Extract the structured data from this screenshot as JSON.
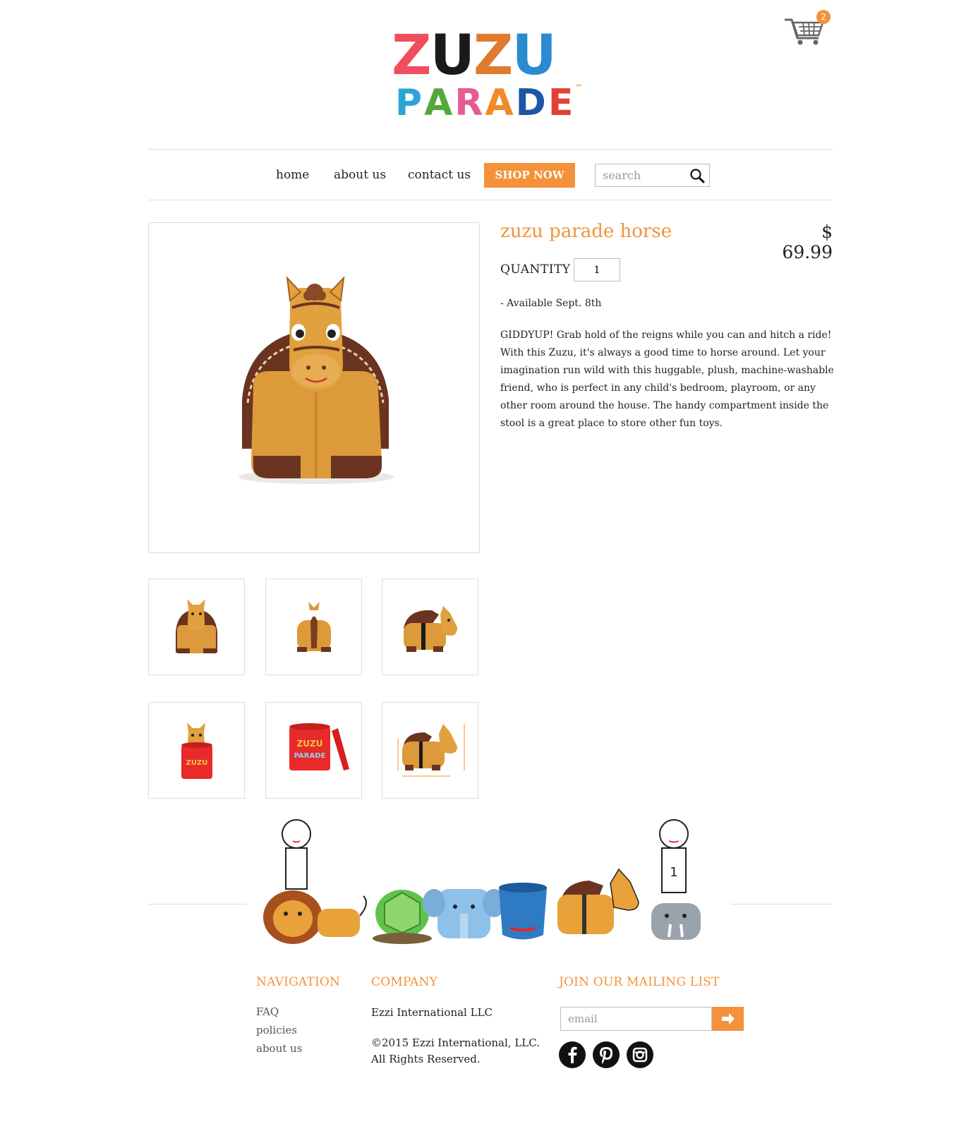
{
  "logo": {
    "top_letters": [
      "Z",
      "U",
      "Z",
      "U"
    ],
    "top_colors": [
      "#ef4f5d",
      "#1a1a1a",
      "#e07a2e",
      "#2b8bd0"
    ],
    "bottom_letters": [
      "P",
      "A",
      "R",
      "A",
      "D",
      "E"
    ],
    "bottom_colors": [
      "#2aa6d6",
      "#54a83c",
      "#e65c93",
      "#f08a2a",
      "#1e56a7",
      "#e23f37"
    ],
    "trademark": "™"
  },
  "cart": {
    "icon": "shopping-cart-icon",
    "count": "2"
  },
  "nav": {
    "home": "home",
    "about": "about us",
    "contact": "contact us",
    "shop": "SHOP NOW",
    "search_placeholder": "search"
  },
  "product": {
    "title": "zuzu parade horse",
    "price": "$ 69.99",
    "quantity_label": "QUANTITY",
    "quantity_value": "1",
    "availability": "- Available Sept. 8th",
    "description": "GIDDYUP! Grab hold of the reigns while you can and hitch a ride! With this Zuzu, it's always a good time to horse around. Let your imagination run wild with this huggable, plush, machine-washable friend, who is perfect in any child's bedroom, playroom, or any other room around the house.  The handy compartment inside the stool is a great place to store other fun toys."
  },
  "footer": {
    "nav_heading": "NAVIGATION",
    "nav_links": [
      "FAQ",
      "policies",
      "about us"
    ],
    "company_heading": "COMPANY",
    "company_name": "Ezzi International LLC",
    "copyright_line1": "©2015 Ezzi International, LLC.",
    "copyright_line2": "All Rights Reserved.",
    "mailing_heading": "JOIN OUR MAILING LIST",
    "email_placeholder": "email",
    "social": [
      "facebook-icon",
      "pinterest-icon",
      "instagram-icon"
    ]
  },
  "colors": {
    "accent": "#f3923a",
    "border": "#dddddd"
  }
}
